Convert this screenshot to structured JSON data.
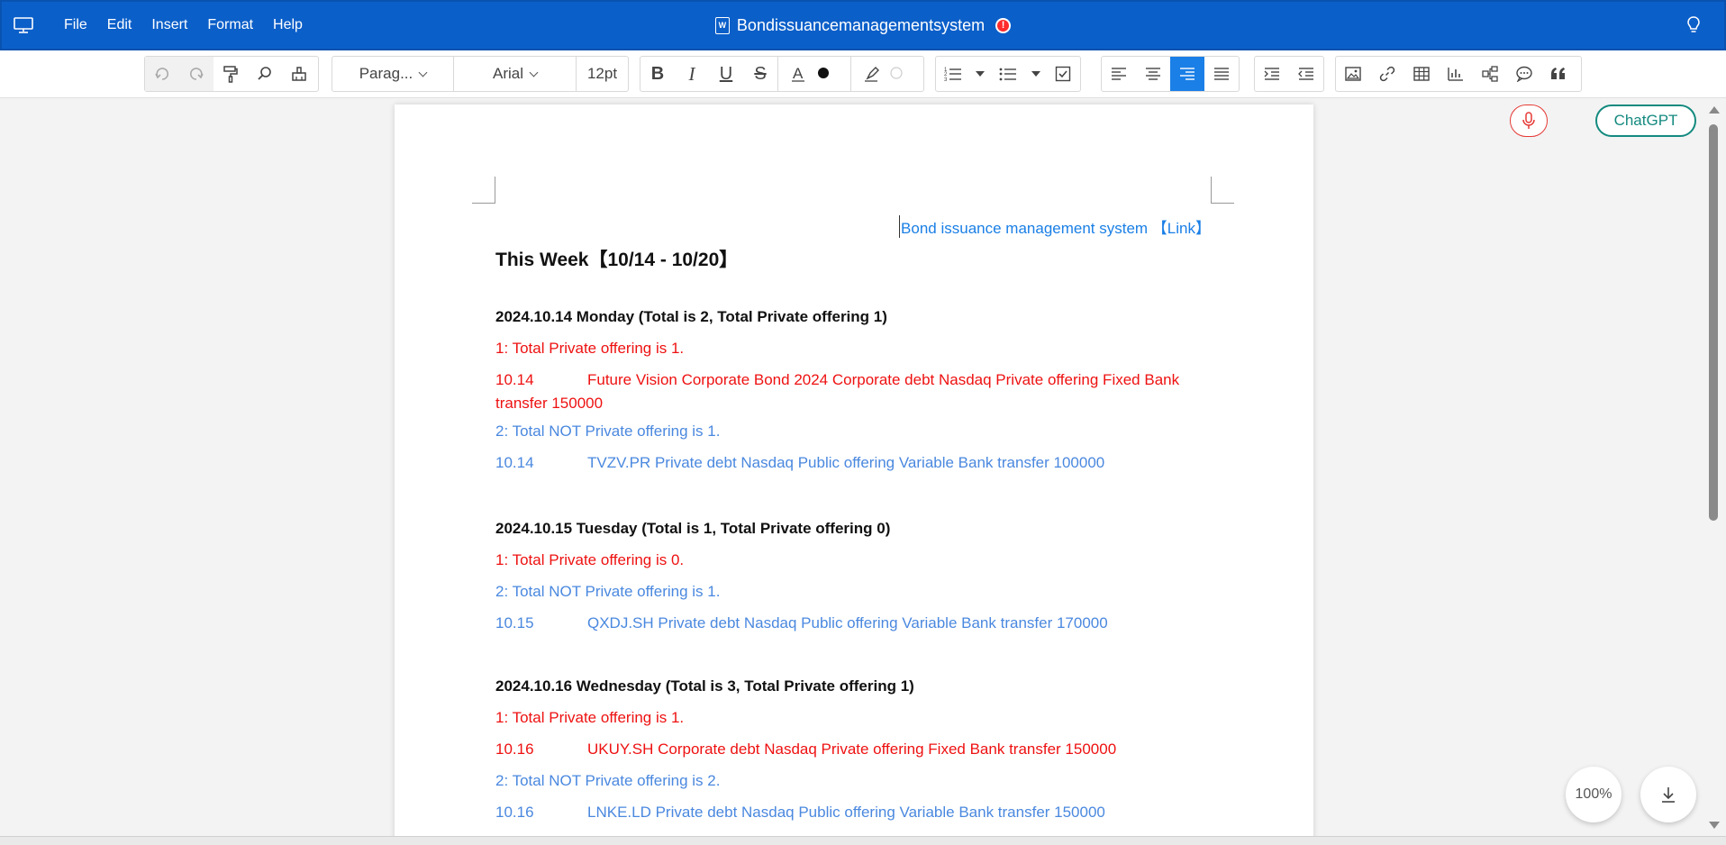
{
  "titlebar": {
    "menu": [
      "File",
      "Edit",
      "Insert",
      "Format",
      "Help"
    ],
    "title": "Bondissuancemanagementsystem",
    "doc_icon_letter": "W",
    "warning_symbol": "!"
  },
  "toolbar": {
    "paragraph_style": "Parag...",
    "font_family": "Arial",
    "font_size": "12pt"
  },
  "document": {
    "link_text": "Bond issuance management system 【Link】",
    "week_title": "This Week【10/14 - 10/20】",
    "days": [
      {
        "header": "2024.10.14 Monday  (Total is 2, Total Private offering 1)",
        "private_summary": "1: Total Private offering is 1.",
        "private_rows": [
          {
            "date": "10.14",
            "text": "Future Vision Corporate Bond 2024  Corporate debt  Nasdaq  Private offering  Fixed  Bank transfer  150000"
          }
        ],
        "public_summary": "2: Total NOT Private offering is 1.",
        "public_rows": [
          {
            "date": "10.14",
            "text": "TVZV.PR  Private debt  Nasdaq  Public offering  Variable  Bank transfer  100000"
          }
        ]
      },
      {
        "header": "2024.10.15 Tuesday  (Total is 1, Total Private offering 0)",
        "private_summary": "1: Total Private offering is 0.",
        "private_rows": [],
        "public_summary": "2: Total NOT Private offering is 1.",
        "public_rows": [
          {
            "date": "10.15",
            "text": "QXDJ.SH  Private debt  Nasdaq  Public offering  Variable  Bank transfer  170000"
          }
        ]
      },
      {
        "header": "2024.10.16 Wednesday  (Total is 3, Total Private offering 1)",
        "private_summary": "1: Total Private offering is 1.",
        "private_rows": [
          {
            "date": "10.16",
            "text": "UKUY.SH  Corporate debt  Nasdaq  Private offering  Fixed  Bank transfer  150000"
          }
        ],
        "public_summary": "2: Total NOT Private offering is 2.",
        "public_rows": [
          {
            "date": "10.16",
            "text": "LNKE.LD  Private debt  Nasdaq  Public offering  Variable  Bank transfer  150000"
          }
        ]
      }
    ]
  },
  "floating": {
    "chatgpt_label": "ChatGPT",
    "zoom_label": "100%"
  },
  "colors": {
    "titlebar": "#0b5fc9",
    "private": "#ee1111",
    "public": "#4a88df",
    "link": "#1a7fe6",
    "active_align": "#1a7fe6",
    "chatgpt": "#148a7f",
    "mic": "#e53935"
  }
}
